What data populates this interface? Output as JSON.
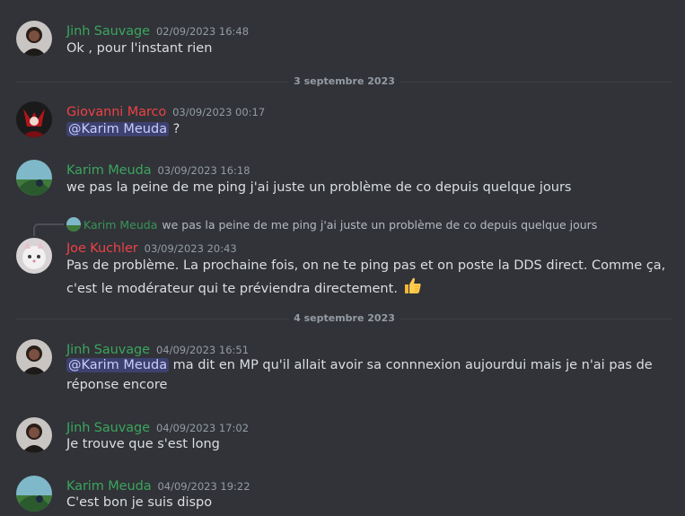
{
  "colors": {
    "background": "#313338",
    "green_user": "#3ba55d",
    "red_user": "#ed4245",
    "timestamp": "#949ba4"
  },
  "dividers": {
    "d1": "3 septembre 2023",
    "d2": "4 septembre 2023"
  },
  "messages": [
    {
      "author": "Jinh Sauvage",
      "timestamp": "02/09/2023 16:48",
      "text": "Ok , pour l'instant rien",
      "avatar": "jinh-avatar"
    },
    {
      "author": "Giovanni Marco",
      "timestamp": "03/09/2023 00:17",
      "mention": "@Karim Meuda",
      "text": " ?",
      "avatar": "giovanni-avatar"
    },
    {
      "author": "Karim Meuda",
      "timestamp": "03/09/2023 16:18",
      "text": "we pas la  peine de me ping j'ai juste un problème de co depuis quelque jours",
      "avatar": "karim-avatar"
    },
    {
      "author": "Joe Kuchler",
      "timestamp": "03/09/2023 20:43",
      "text": "Pas de problème. La prochaine fois, on ne te ping pas et on poste la DDS direct. Comme ça, c'est le modérateur qui te préviendra directement. ",
      "emoji": "thumbs-up",
      "avatar": "joe-avatar",
      "reply": {
        "author": "Karim Meuda",
        "text": "we pas la peine de me ping j'ai juste un problème de co depuis quelque jours"
      }
    },
    {
      "author": "Jinh Sauvage",
      "timestamp": "04/09/2023 16:51",
      "mention": "@Karim Meuda",
      "text": " ma dit en MP qu'il allait avoir sa connnexion aujourdui mais je n'ai pas de réponse encore",
      "avatar": "jinh-avatar"
    },
    {
      "author": "Jinh Sauvage",
      "timestamp": "04/09/2023 17:02",
      "text": "Je trouve que s'est long",
      "avatar": "jinh-avatar"
    },
    {
      "author": "Karim Meuda",
      "timestamp": "04/09/2023 19:22",
      "text": "C'est bon je suis dispo",
      "avatar": "karim-avatar"
    }
  ]
}
